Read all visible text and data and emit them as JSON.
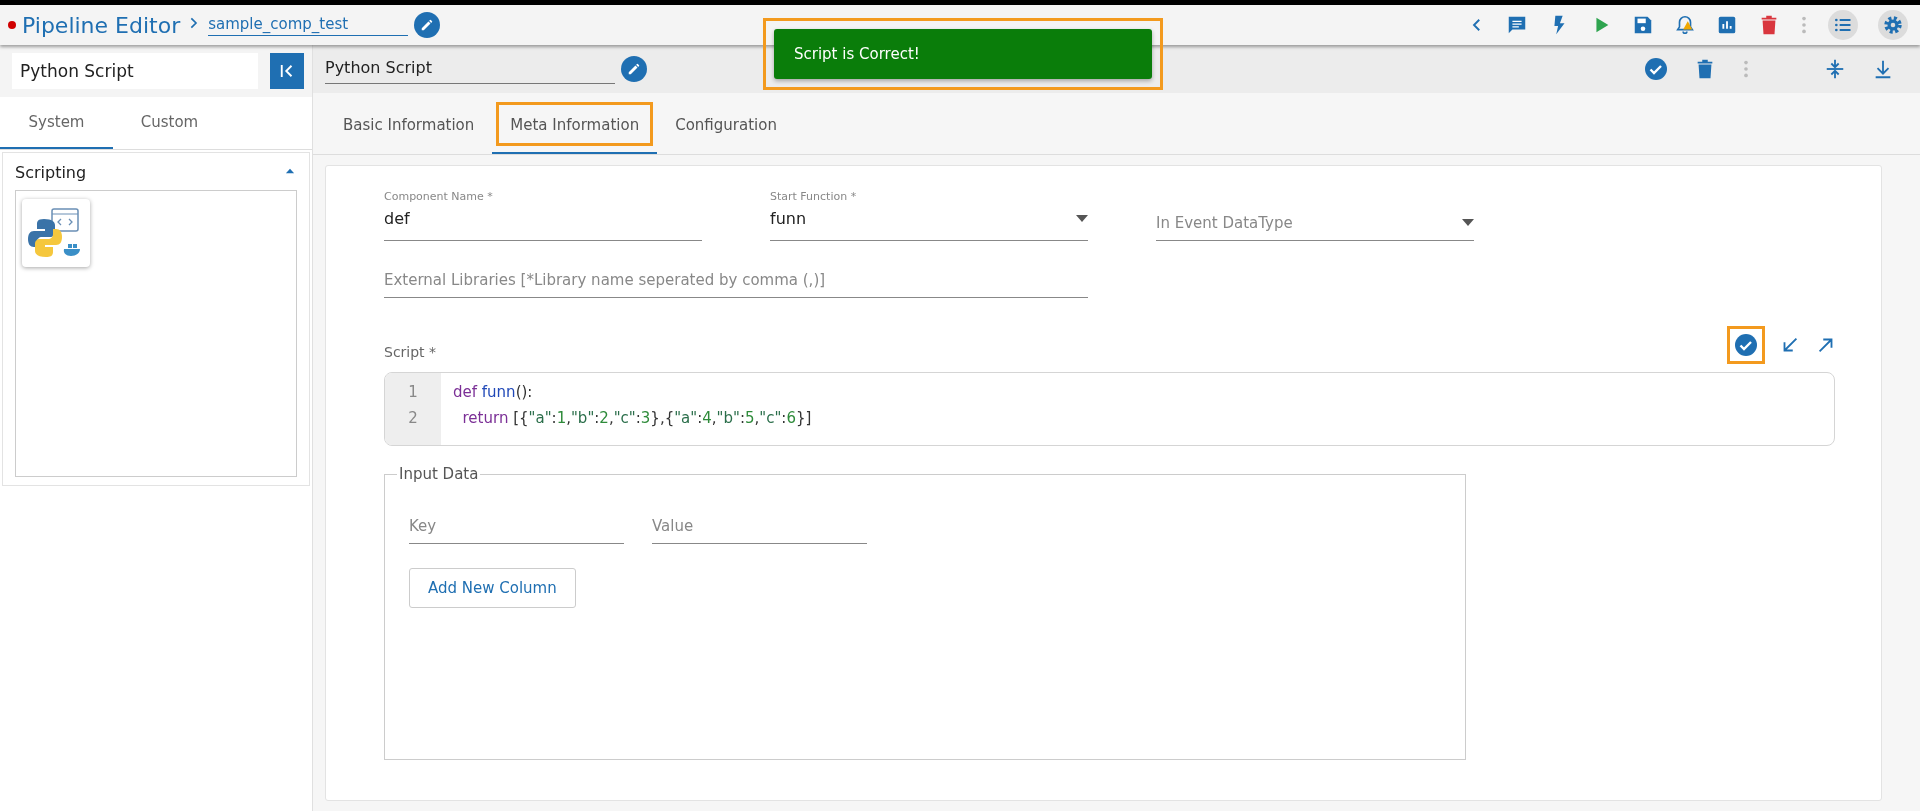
{
  "header": {
    "title": "Pipeline Editor",
    "pipeline_name": "sample_comp_test"
  },
  "toast": {
    "message": "Script is Correct!",
    "highlighted": true
  },
  "sidebar": {
    "search_value": "Python Script",
    "tabs": [
      {
        "label": "System",
        "selected": true
      },
      {
        "label": "Custom",
        "selected": false
      }
    ],
    "section": {
      "title": "Scripting",
      "expanded": true
    }
  },
  "component": {
    "name": "Python Script"
  },
  "tabs": [
    {
      "label": "Basic Information",
      "selected": false,
      "highlighted": false
    },
    {
      "label": "Meta Information",
      "selected": true,
      "highlighted": true
    },
    {
      "label": "Configuration",
      "selected": false,
      "highlighted": false
    }
  ],
  "form": {
    "component_name": {
      "label": "Component Name *",
      "value": "def"
    },
    "start_function": {
      "label": "Start Function *",
      "value": "funn"
    },
    "in_event_datatype": {
      "placeholder": "In Event DataType"
    },
    "external_libraries": {
      "placeholder": "External Libraries [*Library name seperated by comma (,)]"
    },
    "script": {
      "label": "Script *",
      "validate_highlighted": true,
      "lines": [
        {
          "number": "1",
          "tokens": [
            {
              "text": "def ",
              "kind": "keyword"
            },
            {
              "text": "funn",
              "kind": "name"
            },
            {
              "text": "():",
              "kind": "punct"
            }
          ]
        },
        {
          "number": "2",
          "tokens": [
            {
              "text": "  return ",
              "kind": "keyword"
            },
            {
              "text": "[{",
              "kind": "punct"
            },
            {
              "text": "\"a\"",
              "kind": "string"
            },
            {
              "text": ":",
              "kind": "punct"
            },
            {
              "text": "1",
              "kind": "number"
            },
            {
              "text": ",",
              "kind": "punct"
            },
            {
              "text": "\"b\"",
              "kind": "string"
            },
            {
              "text": ":",
              "kind": "punct"
            },
            {
              "text": "2",
              "kind": "number"
            },
            {
              "text": ",",
              "kind": "punct"
            },
            {
              "text": "\"c\"",
              "kind": "string"
            },
            {
              "text": ":",
              "kind": "punct"
            },
            {
              "text": "3",
              "kind": "number"
            },
            {
              "text": "},{",
              "kind": "punct"
            },
            {
              "text": "\"a\"",
              "kind": "string"
            },
            {
              "text": ":",
              "kind": "punct"
            },
            {
              "text": "4",
              "kind": "number"
            },
            {
              "text": ",",
              "kind": "punct"
            },
            {
              "text": "\"b\"",
              "kind": "string"
            },
            {
              "text": ":",
              "kind": "punct"
            },
            {
              "text": "5",
              "kind": "number"
            },
            {
              "text": ",",
              "kind": "punct"
            },
            {
              "text": "\"c\"",
              "kind": "string"
            },
            {
              "text": ":",
              "kind": "punct"
            },
            {
              "text": "6",
              "kind": "number"
            },
            {
              "text": "}]",
              "kind": "punct"
            }
          ]
        }
      ]
    },
    "input_data": {
      "legend": "Input Data",
      "key_placeholder": "Key",
      "value_placeholder": "Value",
      "add_button": "Add New Column"
    }
  }
}
